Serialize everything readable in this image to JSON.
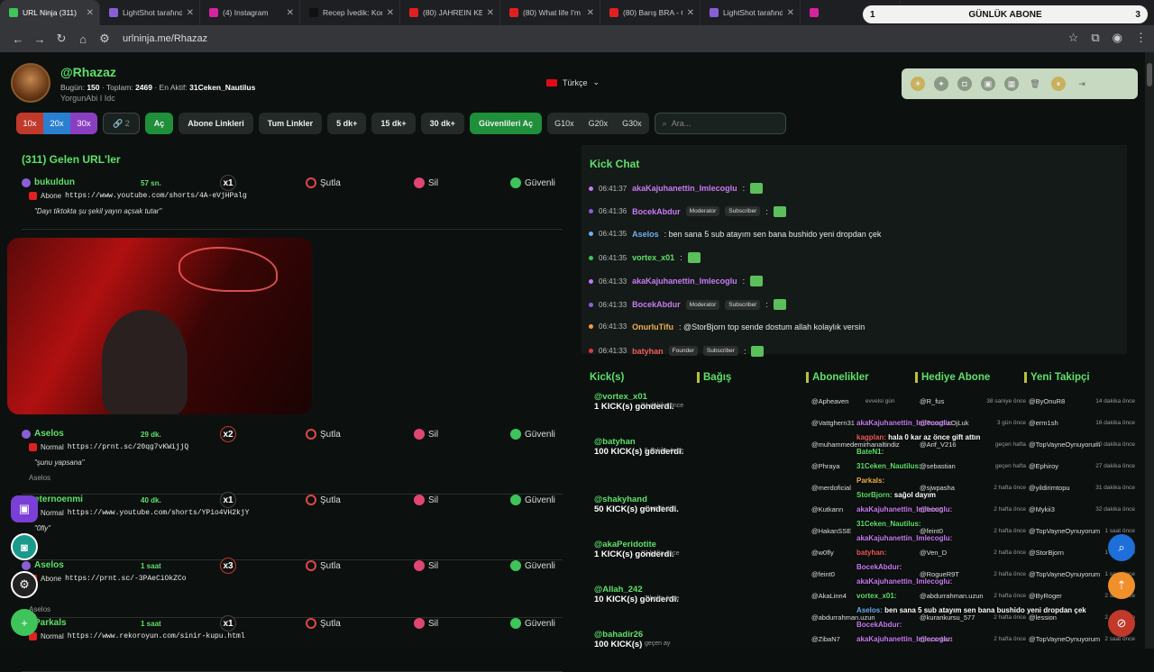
{
  "tabs": [
    {
      "title": "URL Ninja (311)",
      "color": "#3ec45a",
      "active": true
    },
    {
      "title": "LightShot tarafında",
      "color": "#8a5fd6"
    },
    {
      "title": "(4) Instagram",
      "color": "#d6249f"
    },
    {
      "title": "Recep İvedik: Kom",
      "color": "#111111"
    },
    {
      "title": "(80) JAHREIN KEN",
      "color": "#e02020"
    },
    {
      "title": "(80) What life I'm",
      "color": "#e02020"
    },
    {
      "title": "(80) Barış BRA - G",
      "color": "#e02020"
    },
    {
      "title": "LightShot tarafında",
      "color": "#8a5fd6"
    },
    {
      "title": "",
      "color": "#d6249f"
    }
  ],
  "abone_overlay": {
    "left": "1",
    "label": "GÜNLÜK ABONE",
    "right": "3"
  },
  "url": "urlninja.me/Rhazaz",
  "profile": {
    "name": "@Rhazaz",
    "bugun_label": "Bugün:",
    "bugun": "150",
    "toplam_label": "Toplam:",
    "toplam": "2469",
    "aktif_label": "En Aktif:",
    "aktif": "31Ceken_Nautilus",
    "sub": "YorgunAbi I Idc"
  },
  "language": "Türkçe",
  "controls": {
    "x10": "10x",
    "x20": "20x",
    "x30": "30x",
    "link_count": "2",
    "ac": "Aç",
    "abone_links": "Abone Linkleri",
    "tum_links": "Tum Linkler",
    "d5": "5 dk+",
    "d15": "15 dk+",
    "d30": "30 dk+",
    "guvenli_ac": "Güvenlileri Aç",
    "g10": "G10x",
    "g20": "G20x",
    "g30": "G30x",
    "search_placeholder": "Ara..."
  },
  "left_title": "(311) Gelen URL'ler",
  "actions": {
    "sutla": "Şutla",
    "sil": "Sil",
    "guvenli": "Güvenli"
  },
  "rows": [
    {
      "user": "bukuldun",
      "time": "57 sn.",
      "mult": "x1",
      "type": "Abone",
      "link": "https://www.youtube.com/shorts/4A-eVjHPalg",
      "note": "\"Dayı tiktokta şu şekil yayın açsak tutar\"",
      "foot": ""
    },
    {
      "user": "Aselos",
      "time": "29 dk.",
      "mult": "x2",
      "type": "Normal",
      "link": "https://prnt.sc/20qg7vKWijjQ",
      "note": "\"şunu yapsana\"",
      "foot": "Aselos"
    },
    {
      "user": "eternoenmi",
      "time": "40 dk.",
      "mult": "x1",
      "type": "Normal",
      "link": "https://www.youtube.com/shorts/YPio4VH2kjY",
      "note": "\"0fly\"",
      "foot": ""
    },
    {
      "user": "Aselos",
      "time": "1 saat",
      "mult": "x3",
      "type": "Abone",
      "link": "https://prnt.sc/-3PAeCiOkZCo",
      "note": "",
      "foot": "Aselos"
    },
    {
      "user": "Parkals",
      "time": "1 saat",
      "mult": "x1",
      "type": "Normal",
      "link": "https://www.rekoroyun.com/sinir-kupu.html",
      "note": "",
      "foot": ""
    }
  ],
  "chat": {
    "title": "Kick Chat",
    "messages": [
      {
        "time": "06:41:37",
        "name": "akaKajuhanettin_Imlecoglu",
        "color": "#c97af2",
        "dot": "#c97af2",
        "badges": [],
        "text": ":"
      },
      {
        "time": "06:41:36",
        "name": "BocekAbdur",
        "color": "#c97af2",
        "dot": "#8a5fd6",
        "badges": [
          "Moderator",
          "Subscriber"
        ],
        "text": ":"
      },
      {
        "time": "06:41:35",
        "name": "Aselos",
        "color": "#6fb0f0",
        "dot": "#6fb0f0",
        "badges": [],
        "text": ": ben sana 5 sub atayım sen bana bushido yeni dropdan çek"
      },
      {
        "time": "06:41:35",
        "name": "vortex_x01",
        "color": "#5fe06a",
        "dot": "#3ec45a",
        "badges": [],
        "text": ":"
      },
      {
        "time": "06:41:33",
        "name": "akaKajuhanettin_Imlecoglu",
        "color": "#c97af2",
        "dot": "#c97af2",
        "badges": [],
        "text": ":"
      },
      {
        "time": "06:41:33",
        "name": "BocekAbdur",
        "color": "#c97af2",
        "dot": "#8a5fd6",
        "badges": [
          "Moderator",
          "Subscriber"
        ],
        "text": ":"
      },
      {
        "time": "06:41:33",
        "name": "OnurluTifu",
        "color": "#f0b050",
        "dot": "#f0a030",
        "badges": [],
        "text": ": @StorBjorn top sende dostum allah kolaylık versin"
      },
      {
        "time": "06:41:33",
        "name": "batyhan",
        "color": "#f05a5a",
        "dot": "#e03a3a",
        "badges": [
          "Founder",
          "Subscriber"
        ],
        "text": ":"
      }
    ]
  },
  "columns": {
    "kicks": "Kick(s)",
    "bagis": "Bağış",
    "abonelikler": "Abonelikler",
    "hediye": "Hediye Abone",
    "takipci": "Yeni Takipçi"
  },
  "kicks": [
    {
      "user": "@vortex_x01",
      "text": "1 KICK(s) gönderdi.",
      "time": "4 dakika önce"
    },
    {
      "user": "@batyhan",
      "text": "100 KICK(s) gönderdi.",
      "time": "5 dakika önce"
    },
    {
      "user": "@shakyhand",
      "text": "50 KICK(s) gönderdi.",
      "time": "evvelsi gün"
    },
    {
      "user": "@akaPeridotite",
      "text": "1 KICK(s) gönderdi.",
      "time": "2 hafta önce"
    },
    {
      "user": "@Allah_242",
      "text": "10 KICK(s) gönderdi.",
      "time": "2 hafta önce"
    },
    {
      "user": "@bahadir26",
      "text": "100 KICK(s)",
      "time": "geçen ay"
    }
  ],
  "abonelikler": [
    {
      "u": "@Apheaven",
      "t": "evvelsi gün"
    },
    {
      "u": "@Vattghern31",
      "t": ""
    },
    {
      "u": "@muhammedemirhanaltindiz",
      "t": ""
    },
    {
      "u": "@Phraya",
      "t": ""
    },
    {
      "u": "@merdoficial",
      "t": ""
    },
    {
      "u": "@Kutkann",
      "t": ""
    },
    {
      "u": "@HakanSSE",
      "t": ""
    },
    {
      "u": "@w0fly",
      "t": ""
    },
    {
      "u": "@feint0",
      "t": ""
    },
    {
      "u": "@AkaLinn4",
      "t": ""
    },
    {
      "u": "@abdurrahman.uzun",
      "t": ""
    },
    {
      "u": "@ZibaN7",
      "t": ""
    }
  ],
  "hediye": [
    {
      "u": "@R_fus",
      "t": "38 saniye önce"
    },
    {
      "u": "@TuncBluOjLuk",
      "t": "3 gün önce"
    },
    {
      "u": "@Arif_V216",
      "t": "geçen hafta"
    },
    {
      "u": "@sebastian",
      "t": "geçen hafta"
    },
    {
      "u": "@sjwpasha",
      "t": "2 hafta önce"
    },
    {
      "u": "@feint0",
      "t": "2 hafta önce"
    },
    {
      "u": "@feint0",
      "t": "2 hafta önce"
    },
    {
      "u": "@Ven_D",
      "t": "2 hafta önce"
    },
    {
      "u": "@RogueR9T",
      "t": "2 hafta önce"
    },
    {
      "u": "@abdurrahman.uzun",
      "t": "2 hafta önce"
    },
    {
      "u": "@kurankursu_577",
      "t": "2 hafta önce"
    },
    {
      "u": "@uzunkurt",
      "t": "2 hafta önce"
    }
  ],
  "takipci": [
    {
      "u": "@ByOnuR8",
      "t": "14 dakika önce"
    },
    {
      "u": "@erm1sh",
      "t": "16 dakika önce"
    },
    {
      "u": "@TopVayneOynuyorum",
      "t": "20 dakika önce"
    },
    {
      "u": "@Ephiroy",
      "t": "27 dakika önce"
    },
    {
      "u": "@yildirimtopu",
      "t": "31 dakika önce"
    },
    {
      "u": "@Mykii3",
      "t": "32 dakika önce"
    },
    {
      "u": "@TopVayneOynuyorum",
      "t": "1 saat önce"
    },
    {
      "u": "@StorBjorn",
      "t": "1 saat önce"
    },
    {
      "u": "@TopVayneOynuyorum",
      "t": "1 saat önce"
    },
    {
      "u": "@ByRoger",
      "t": "2 saat önce"
    },
    {
      "u": "@lession",
      "t": "2 saat önce"
    },
    {
      "u": "@TopVayneOynuyorum",
      "t": "2 saat önce"
    }
  ],
  "overlay_chat": [
    {
      "n": "akaKajuhanettin_Imlecoglu:",
      "t": "",
      "c": "#c97af2"
    },
    {
      "n": "kagplan:",
      "t": "hala 0 kar az önce gift attın",
      "c": "#f05a5a"
    },
    {
      "n": "BateN1:",
      "t": "",
      "c": "#5fe06a"
    },
    {
      "n": "31Ceken_Nautilus:",
      "t": "",
      "c": "#5fe06a"
    },
    {
      "n": "Parkals:",
      "t": "",
      "c": "#f0b050"
    },
    {
      "n": "StorBjorn:",
      "t": "sağol dayım",
      "c": "#5fe06a"
    },
    {
      "n": "akaKajuhanettin_Imlecoglu:",
      "t": "",
      "c": "#c97af2"
    },
    {
      "n": "31Ceken_Nautilus:",
      "t": "",
      "c": "#5fe06a"
    },
    {
      "n": "akaKajuhanettin_Imlecoglu:",
      "t": "",
      "c": "#c97af2"
    },
    {
      "n": "batyhan:",
      "t": "",
      "c": "#f05a5a"
    },
    {
      "n": "BocekAbdur:",
      "t": "",
      "c": "#c97af2"
    },
    {
      "n": "akaKajuhanettin_Imlecoglu:",
      "t": "",
      "c": "#c97af2"
    },
    {
      "n": "vortex_x01:",
      "t": "",
      "c": "#5fe06a"
    },
    {
      "n": "Aselos:",
      "t": "ben sana 5 sub atayım sen bana bushido yeni dropdan çek",
      "c": "#6fb0f0"
    },
    {
      "n": "BocekAbdur:",
      "t": "",
      "c": "#c97af2"
    },
    {
      "n": "akaKajuhanettin_Imlecoglu:",
      "t": "",
      "c": "#c97af2"
    }
  ]
}
